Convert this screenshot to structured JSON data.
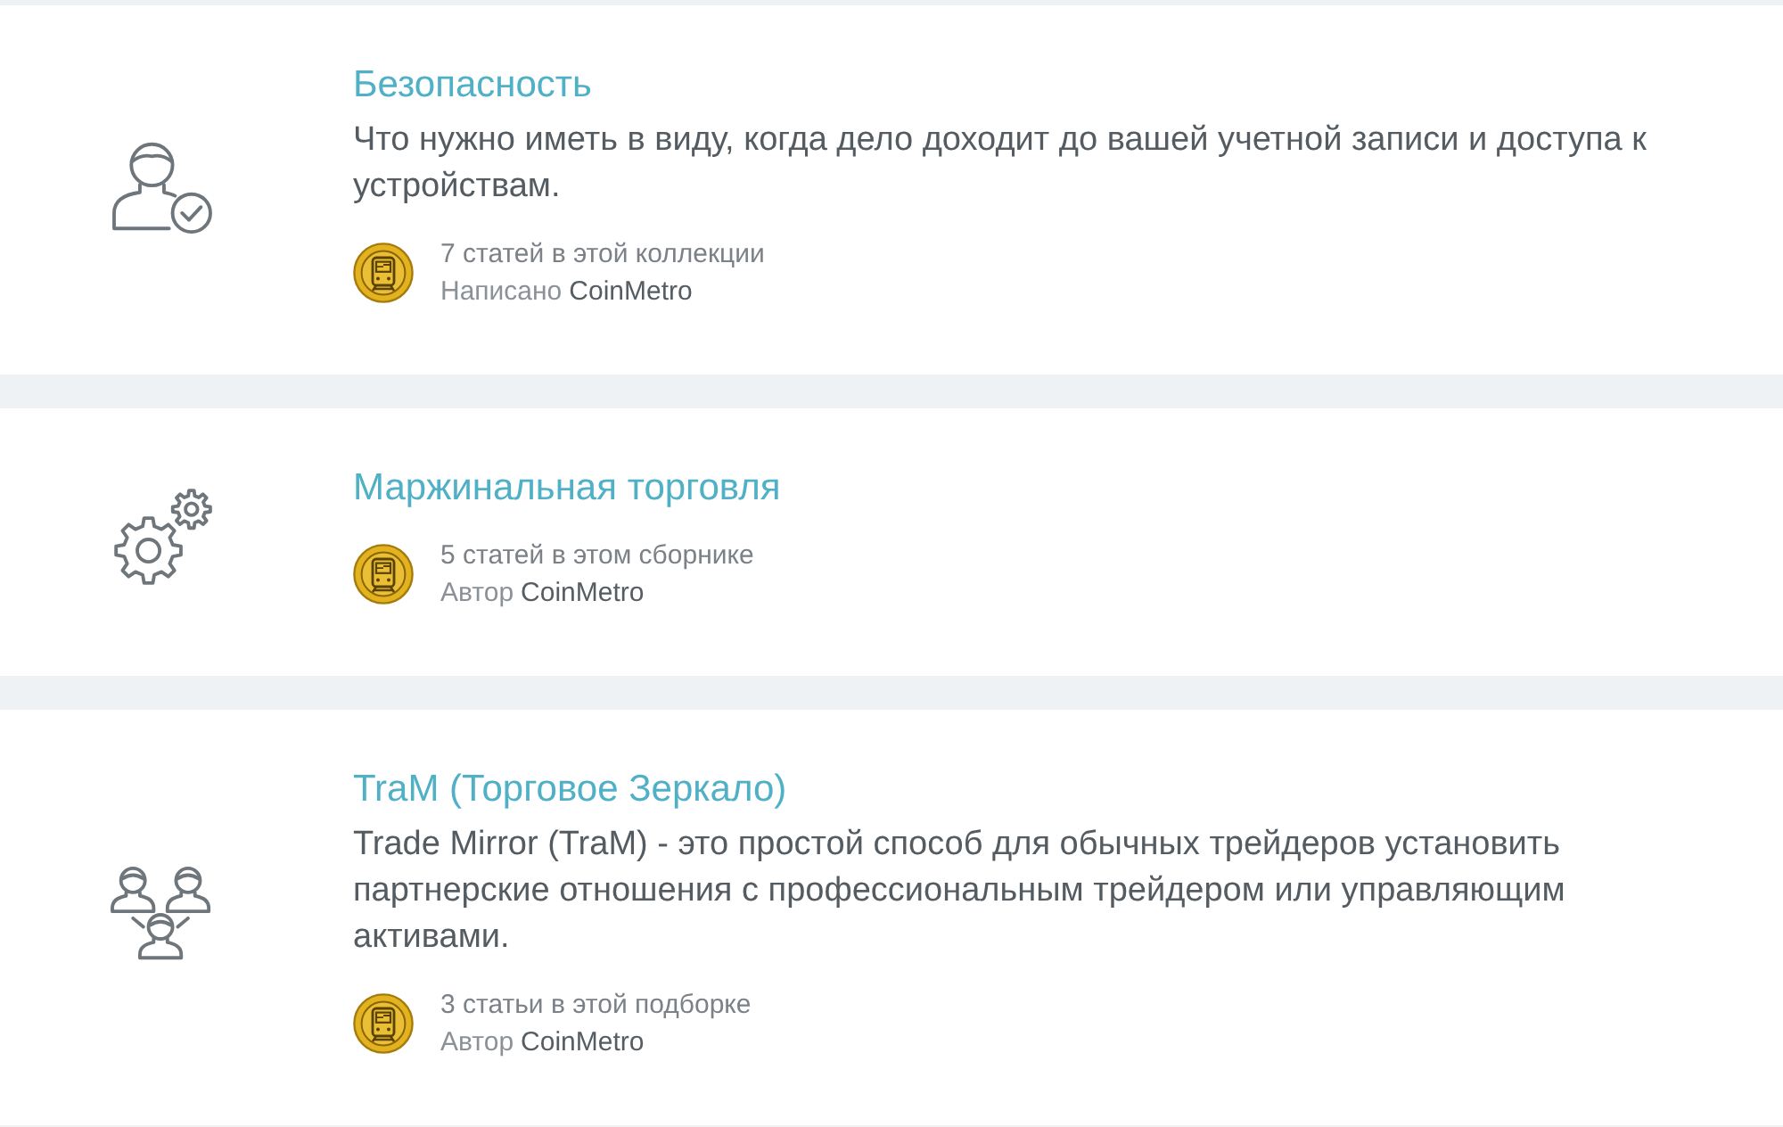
{
  "collections": [
    {
      "kind": "usercheck",
      "title": "Безопасность",
      "description": "Что нужно иметь в виду, когда дело доходит до вашей учетной записи и доступа к устройствам.",
      "count": "7 статей в этой коллекции",
      "author_label": "Написано",
      "author": "CoinMetro"
    },
    {
      "kind": "gears",
      "title": "Маржинальная торговля",
      "count": "5 статей в этом сборнике",
      "author_label": "Автор",
      "author": "CoinMetro"
    },
    {
      "kind": "team",
      "title": "TraM (Торговое Зеркало)",
      "description": "Trade Mirror (TraM) - это простой способ для обычных трейдеров установить партнерские отношения с профессиональным трейдером или управляющим активами.",
      "count": "3 статьи в этой подборке",
      "author_label": "Автор",
      "author": "CoinMetro"
    }
  ]
}
